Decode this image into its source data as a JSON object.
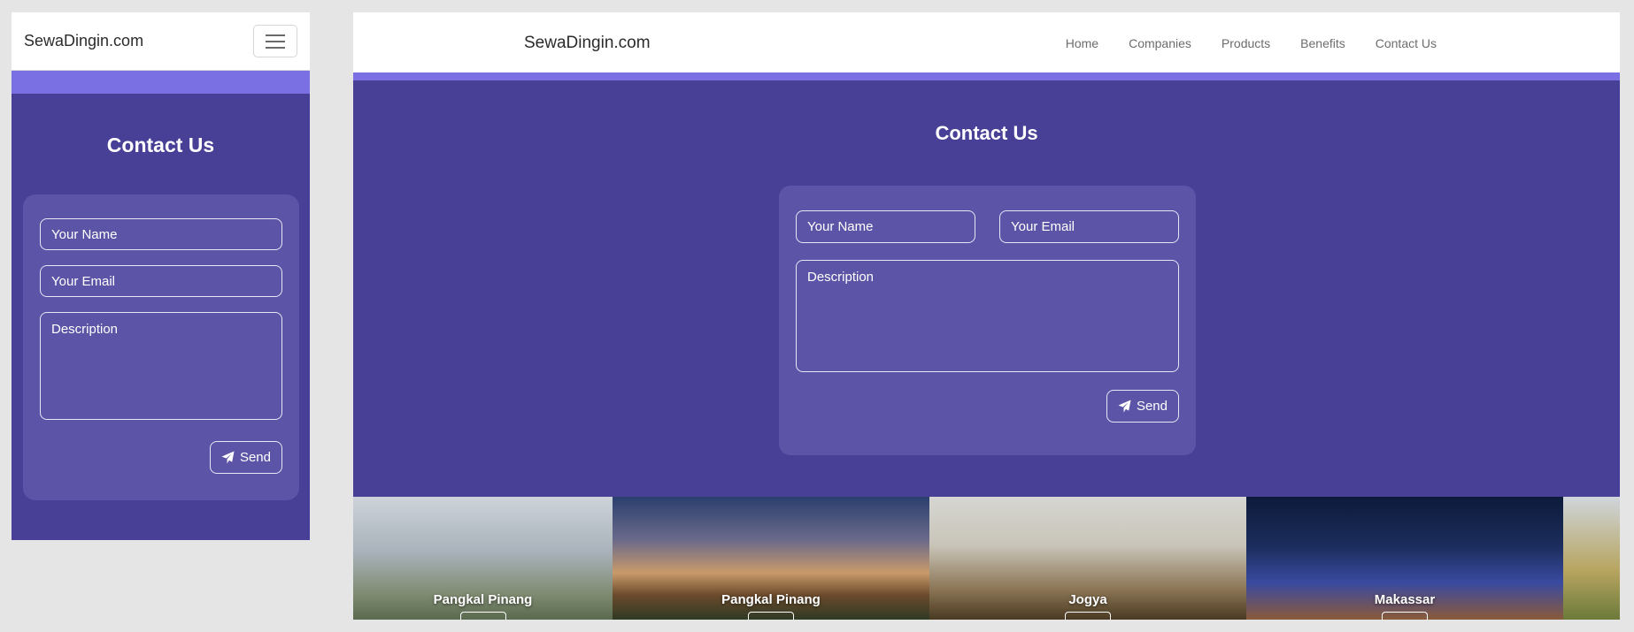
{
  "brand": "SewaDingin.com",
  "nav": [
    "Home",
    "Companies",
    "Products",
    "Benefits",
    "Contact Us"
  ],
  "contact": {
    "title": "Contact Us",
    "name_placeholder": "Your Name",
    "email_placeholder": "Your Email",
    "description_placeholder": "Description",
    "send_label": "Send"
  },
  "cities": [
    "Pangkal Pinang",
    "Pangkal Pinang",
    "Jogya",
    "Makassar"
  ],
  "colors": {
    "section_bg": "#483f97",
    "card_bg": "#5c54a6",
    "accent_strip": "#7b70e3"
  }
}
